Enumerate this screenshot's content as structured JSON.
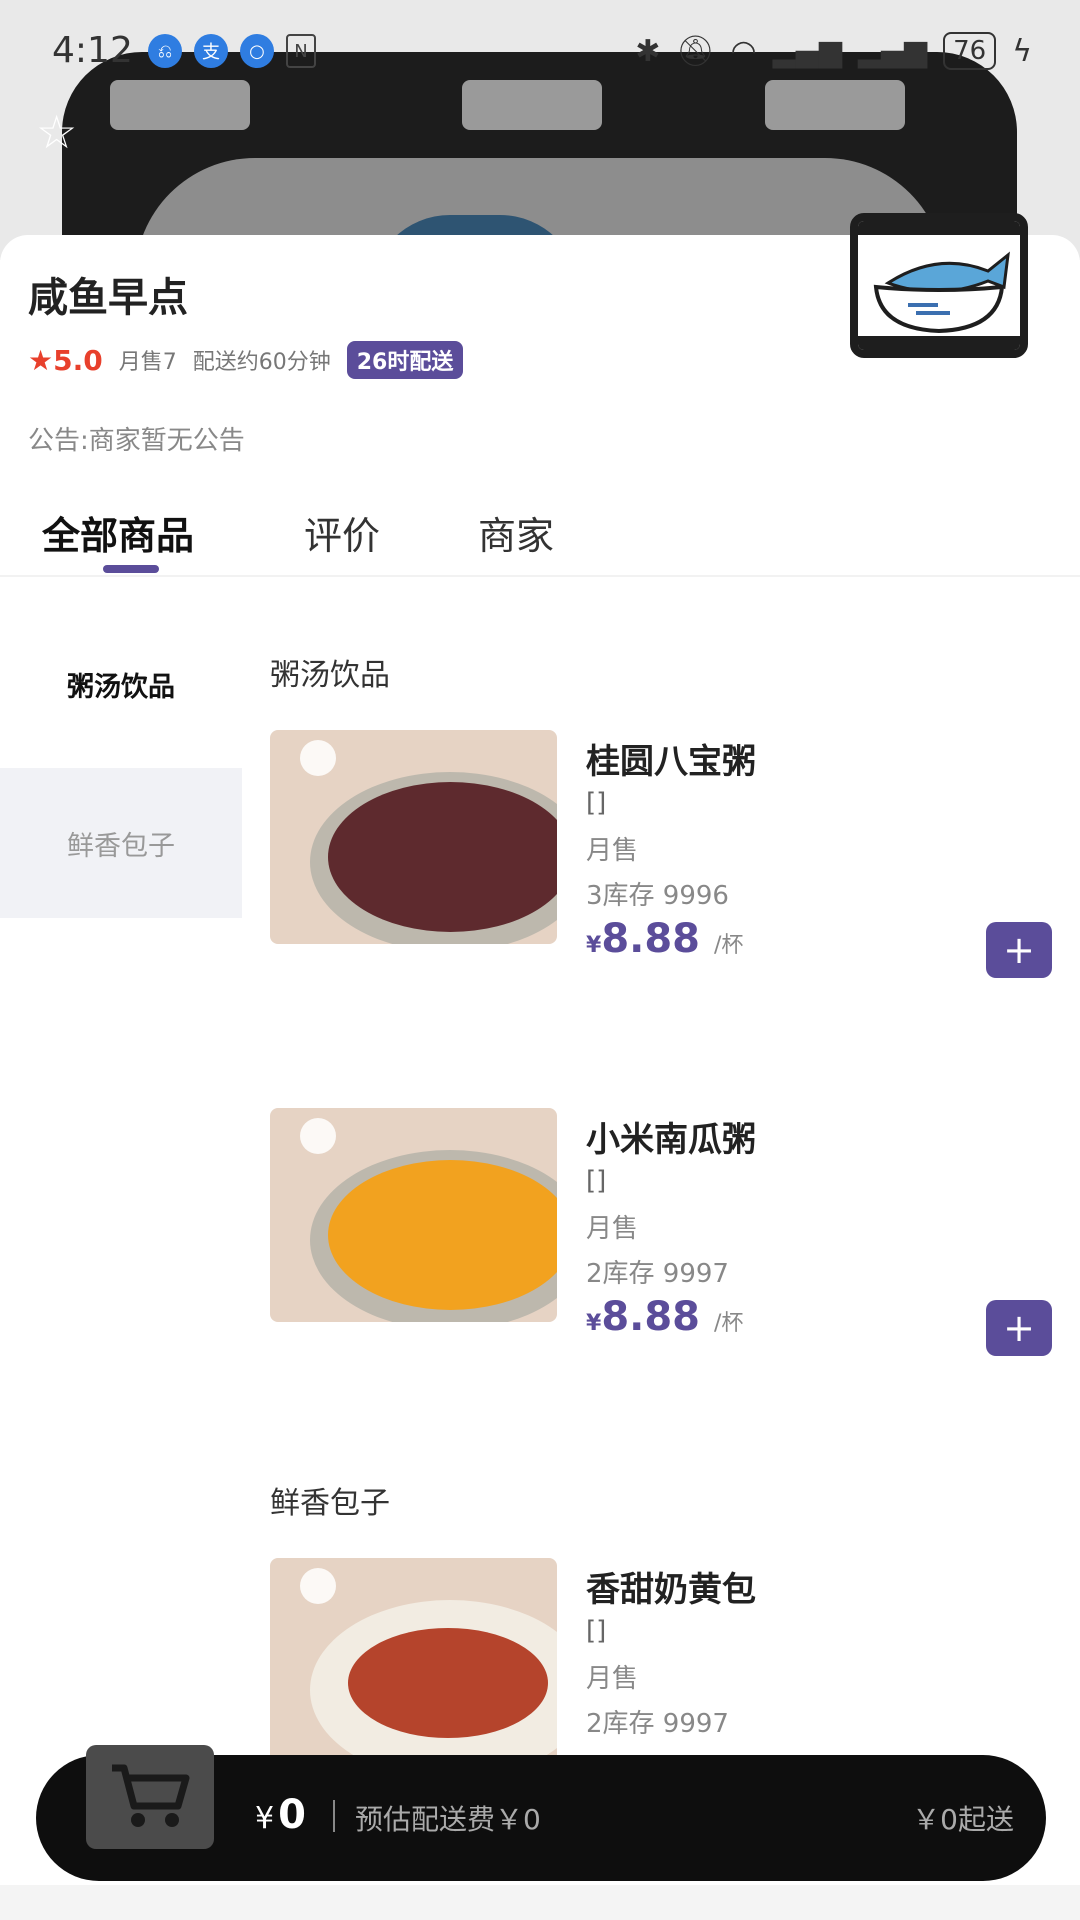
{
  "status_bar": {
    "time": "4:12",
    "battery": "76"
  },
  "store": {
    "name": "咸鱼早点",
    "rating": "5.0",
    "monthly_sales": "月售7",
    "delivery_time": "配送约60分钟",
    "badge": "26时配送",
    "notice": "公告:商家暂无公告"
  },
  "tabs": [
    {
      "label": "全部商品",
      "active": true
    },
    {
      "label": "评价",
      "active": false
    },
    {
      "label": "商家",
      "active": false
    }
  ],
  "categories": [
    {
      "label": "粥汤饮品",
      "active": true
    },
    {
      "label": "鲜香包子",
      "active": false
    }
  ],
  "sections": [
    {
      "title": "粥汤饮品",
      "products": [
        {
          "name": "桂圆八宝粥",
          "desc": "[]",
          "sales": "月售",
          "stock": "3库存 9996",
          "currency": "¥",
          "price": "8.88",
          "unit": "/杯"
        },
        {
          "name": "小米南瓜粥",
          "desc": "[]",
          "sales": "月售",
          "stock": "2库存 9997",
          "currency": "¥",
          "price": "8.88",
          "unit": "/杯"
        }
      ]
    },
    {
      "title": "鲜香包子",
      "products": [
        {
          "name": "香甜奶黄包",
          "desc": "[]",
          "sales": "月售",
          "stock": "2库存 9997"
        }
      ]
    }
  ],
  "cart": {
    "currency": "¥",
    "total": "0",
    "delivery_fee": "预估配送费￥0",
    "minimum": "￥0起送"
  },
  "colors": {
    "accent": "#5b4d9a",
    "rating": "#e8402c",
    "cart_bar": "#0e0e0e"
  },
  "icons": {
    "favorite": "star-outline-icon",
    "cart": "shopping-cart-icon",
    "add": "plus-icon"
  }
}
